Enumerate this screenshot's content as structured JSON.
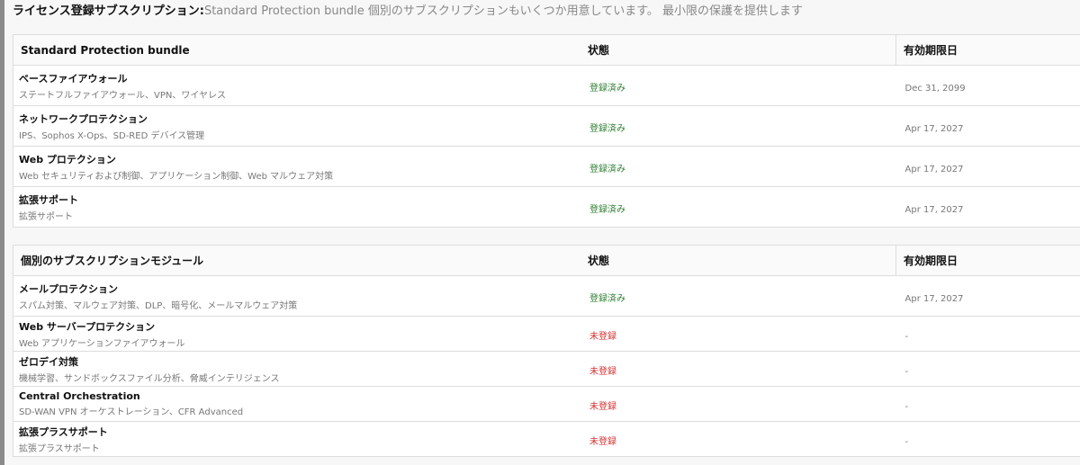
{
  "heading": {
    "label": "ライセンス登録サブスクリプション:",
    "text": "Standard Protection bundle 個別のサブスクリプションもいくつか用意しています。 最小限の保護を提供します"
  },
  "bundle": {
    "headers": [
      "Standard Protection bundle",
      "状態",
      "有効期限日"
    ],
    "rows": [
      {
        "name": "ベースファイアウォール",
        "desc": "ステートフルファイアウォール、VPN、ワイヤレス",
        "status": "登録済み",
        "expiry": "Dec 31, 2099"
      },
      {
        "name": "ネットワークプロテクション",
        "desc": "IPS、Sophos X-Ops、SD-RED デバイス管理",
        "status": "登録済み",
        "expiry": "Apr 17, 2027"
      },
      {
        "name": "Web プロテクション",
        "desc": "Web セキュリティおよび制御、アプリケーション制御、Web マルウェア対策",
        "status": "登録済み",
        "expiry": "Apr 17, 2027"
      },
      {
        "name": "拡張サポート",
        "desc": "拡張サポート",
        "status": "登録済み",
        "expiry": "Apr 17, 2027"
      }
    ]
  },
  "modules": {
    "headers": [
      "個別のサブスクリプションモジュール",
      "状態",
      "有効期限日"
    ],
    "rows": [
      {
        "name": "メールプロテクション",
        "desc": "スパム対策、マルウェア対策、DLP、暗号化、メールマルウェア対策",
        "status": "登録済み",
        "registered": true,
        "expiry": "Apr 17, 2027"
      },
      {
        "name": "Web サーバープロテクション",
        "desc": "Web アプリケーションファイアウォール",
        "status": "未登録",
        "registered": false,
        "expiry": "-"
      },
      {
        "name": "ゼロデイ対策",
        "desc": "機械学習、サンドボックスファイル分析、脅威インテリジェンス",
        "status": "未登録",
        "registered": false,
        "expiry": "-"
      },
      {
        "name": "Central Orchestration",
        "desc": "SD-WAN VPN オーケストレーション、CFR Advanced",
        "status": "未登録",
        "registered": false,
        "expiry": "-"
      },
      {
        "name": "拡張プラスサポート",
        "desc": "拡張プラスサポート",
        "status": "未登録",
        "registered": false,
        "expiry": "-"
      }
    ]
  },
  "colors": {
    "registered": "#2e7d32",
    "unregistered": "#d32f2f"
  }
}
